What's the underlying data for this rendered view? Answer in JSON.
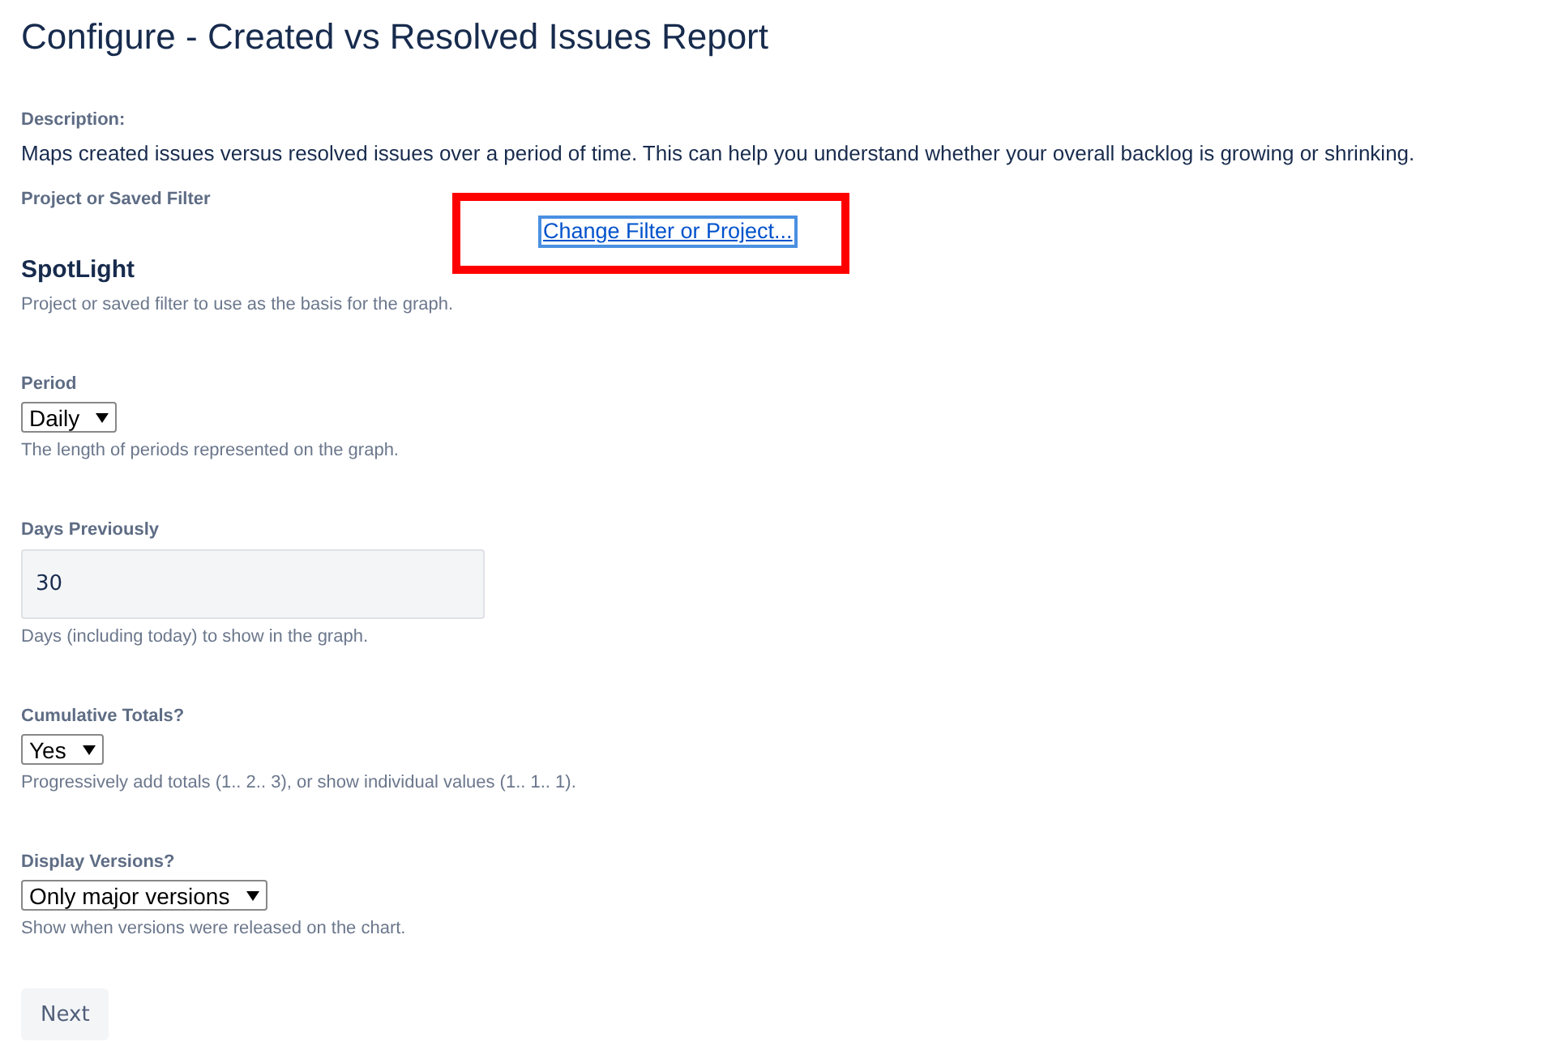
{
  "title": "Configure - Created vs Resolved Issues Report",
  "description": {
    "label": "Description:",
    "text": "Maps created issues versus resolved issues over a period of time. This can help you understand whether your overall backlog is growing or shrinking."
  },
  "filter": {
    "label": "Project or Saved Filter",
    "link": "Change Filter or Project...",
    "highlighted": true,
    "name": "SpotLight",
    "help": "Project or saved filter to use as the basis for the graph."
  },
  "fields": [
    {
      "kind": "select",
      "label": "Period",
      "value": "Daily",
      "help": "The length of periods represented on the graph."
    },
    {
      "kind": "text",
      "label": "Days Previously",
      "value": "30",
      "help": "Days (including today) to show in the graph."
    },
    {
      "kind": "select",
      "label": "Cumulative Totals?",
      "value": "Yes",
      "help": "Progressively add totals (1.. 2.. 3), or show individual values (1.. 1.. 1)."
    },
    {
      "kind": "select",
      "label": "Display Versions?",
      "value": "Only major versions",
      "help": "Show when versions were released on the chart."
    }
  ],
  "button": "Next"
}
